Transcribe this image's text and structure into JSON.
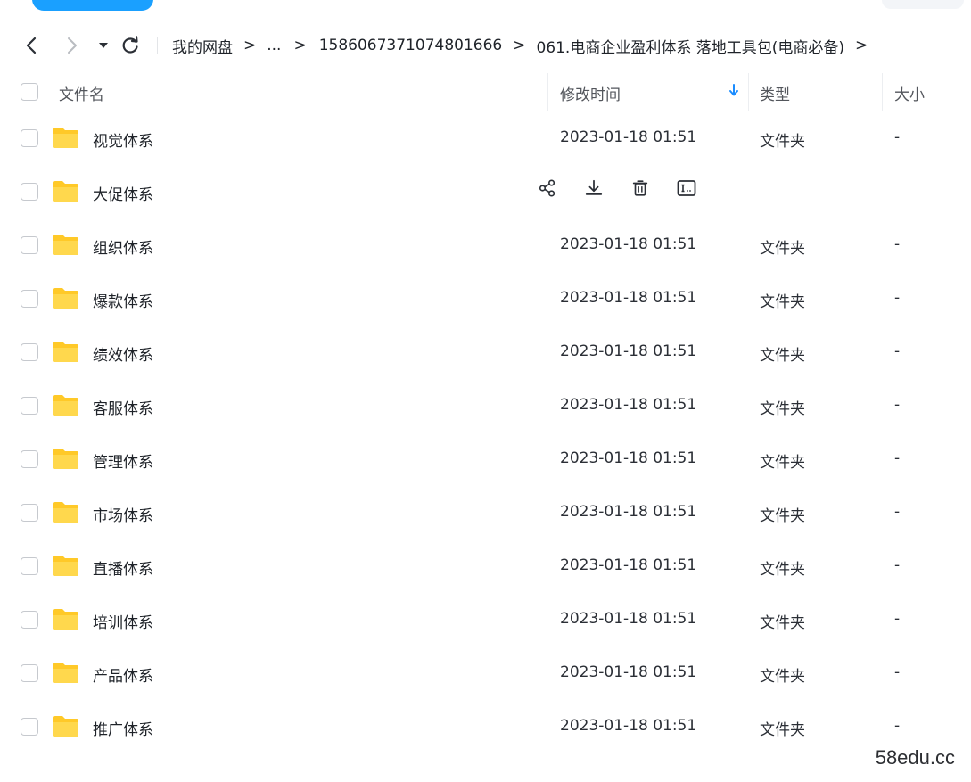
{
  "nav": {
    "back_icon": "chevron-left-icon",
    "forward_icon": "chevron-right-icon",
    "dropdown_icon": "triangle-down-icon",
    "refresh_icon": "refresh-icon"
  },
  "breadcrumb": [
    {
      "label": "我的网盘"
    },
    {
      "label": "..."
    },
    {
      "label": "1586067371074801666"
    },
    {
      "label": "061.电商企业盈利体系 落地工具包(电商必备)"
    }
  ],
  "breadcrumb_sep": ">",
  "columns": {
    "name": "文件名",
    "modified": "修改时间",
    "type": "类型",
    "size": "大小",
    "sort_icon": "arrow-down-icon"
  },
  "rows": [
    {
      "name": "视觉体系",
      "date": "2023-01-18 01:51",
      "type": "文件夹",
      "size": "-"
    },
    {
      "name": "大促体系",
      "date": "",
      "type": "",
      "size": "",
      "hovered": true
    },
    {
      "name": "组织体系",
      "date": "2023-01-18 01:51",
      "type": "文件夹",
      "size": "-"
    },
    {
      "name": "爆款体系",
      "date": "2023-01-18 01:51",
      "type": "文件夹",
      "size": "-"
    },
    {
      "name": "绩效体系",
      "date": "2023-01-18 01:51",
      "type": "文件夹",
      "size": "-"
    },
    {
      "name": "客服体系",
      "date": "2023-01-18 01:51",
      "type": "文件夹",
      "size": "-"
    },
    {
      "name": "管理体系",
      "date": "2023-01-18 01:51",
      "type": "文件夹",
      "size": "-"
    },
    {
      "name": "市场体系",
      "date": "2023-01-18 01:51",
      "type": "文件夹",
      "size": "-"
    },
    {
      "name": "直播体系",
      "date": "2023-01-18 01:51",
      "type": "文件夹",
      "size": "-"
    },
    {
      "name": "培训体系",
      "date": "2023-01-18 01:51",
      "type": "文件夹",
      "size": "-"
    },
    {
      "name": "产品体系",
      "date": "2023-01-18 01:51",
      "type": "文件夹",
      "size": "-"
    },
    {
      "name": "推广体系",
      "date": "2023-01-18 01:51",
      "type": "文件夹",
      "size": "-"
    }
  ],
  "row_actions": [
    "share-icon",
    "download-icon",
    "delete-icon",
    "rename-icon"
  ],
  "watermark": "58edu.cc",
  "colors": {
    "accent": "#1aa0ff",
    "folder": "#ffd43b",
    "sort_arrow": "#1a8cff",
    "text": "#1f2329"
  }
}
